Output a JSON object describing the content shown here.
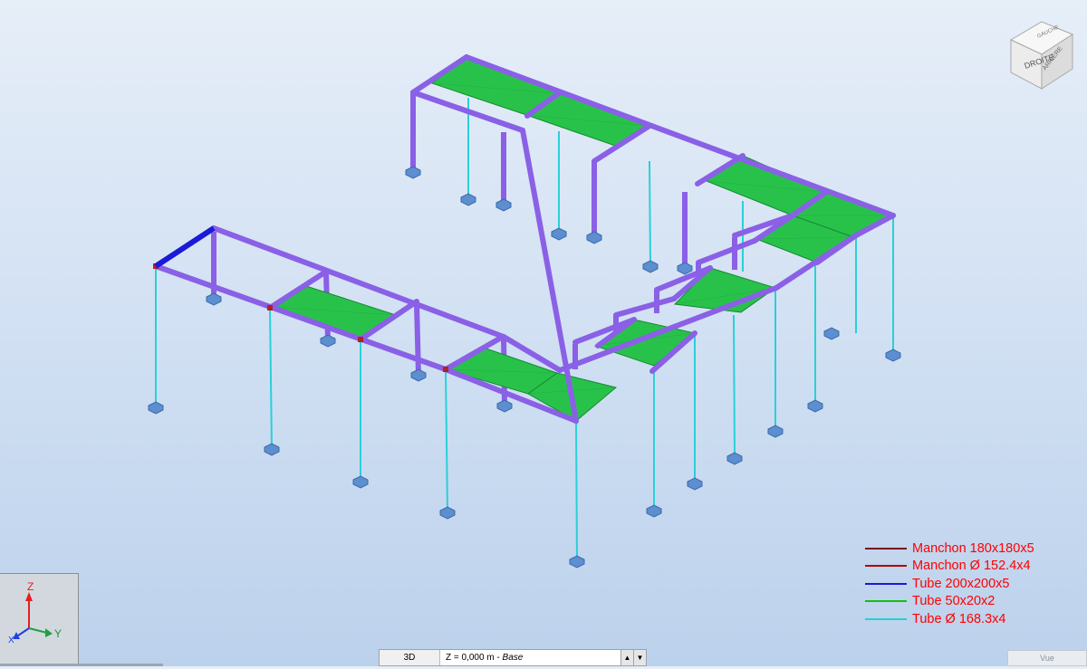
{
  "viewcube": {
    "face_front": "DROITE",
    "face_right": "ARRIÈRE",
    "face_top": "GAUCHE"
  },
  "axes": {
    "z": "Z",
    "y": "Y",
    "x": "X"
  },
  "legend": [
    {
      "label": "Manchon 180x180x5",
      "color": "#7a1010"
    },
    {
      "label": "Manchon Ø 152.4x4",
      "color": "#b00000"
    },
    {
      "label": "Tube 200x200x5",
      "color": "#1a1ad8"
    },
    {
      "label": "Tube 50x20x2",
      "color": "#10c010"
    },
    {
      "label": "Tube Ø 168.3x4",
      "color": "#22d2d2"
    }
  ],
  "bottombar": {
    "view_mode": "3D",
    "level_prefix": "Z = 0,000 m - ",
    "level_name": "Base",
    "spin_up": "▲",
    "spin_down": "▼"
  },
  "vue_label": "Vue",
  "colors": {
    "beam": "#8a60e6",
    "deck": "#28c24a",
    "column": "#2ad0d8",
    "sleeve": "#b32020",
    "footing": "#5c8ed0"
  }
}
